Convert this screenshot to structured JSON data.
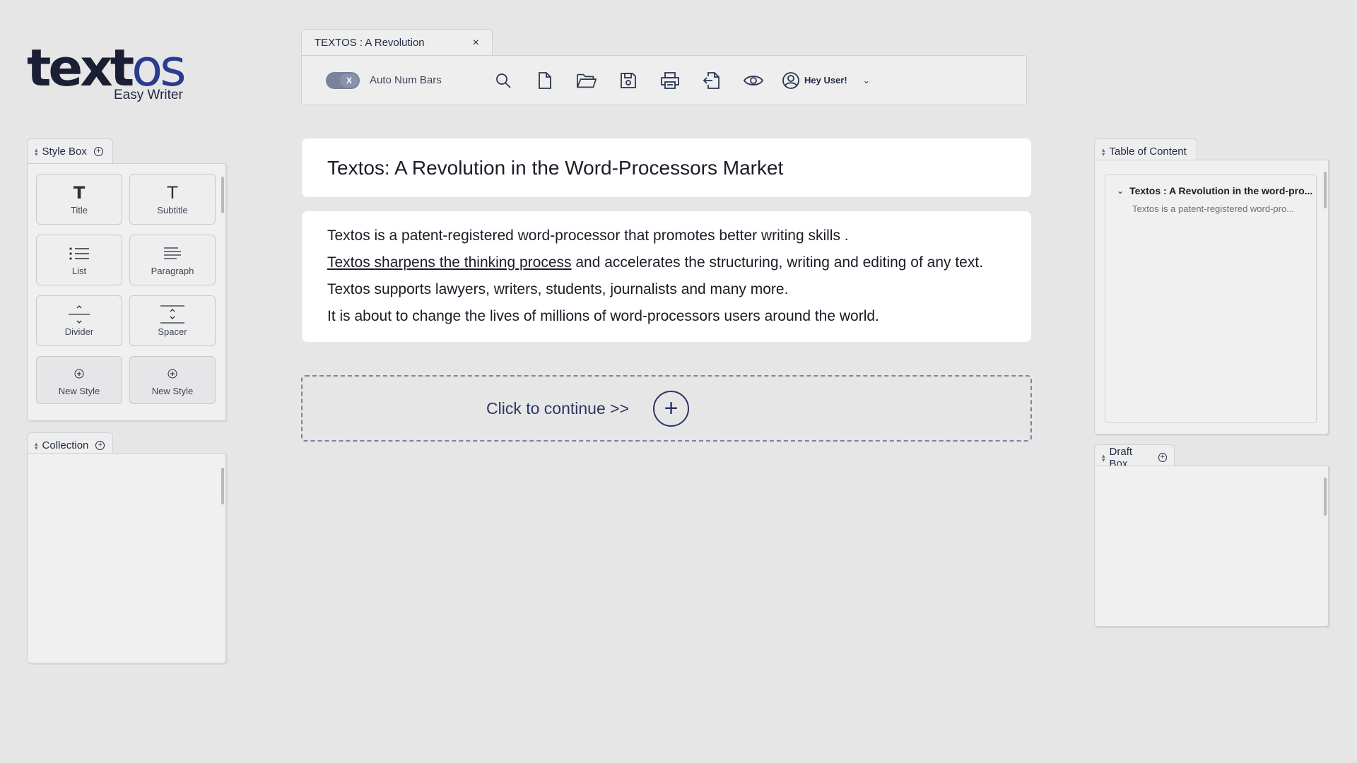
{
  "logo": {
    "word_dark": "text",
    "word_accent": "os",
    "subtitle": "Easy Writer"
  },
  "document_tab": {
    "title": "TEXTOS : A Revolution",
    "close": "×"
  },
  "toolbar": {
    "toggle_state": "X",
    "toggle_label": "Auto Num Bars",
    "icons": [
      "search-icon",
      "new-file-icon",
      "open-folder-icon",
      "save-icon",
      "print-icon",
      "export-icon",
      "preview-icon",
      "user-icon"
    ],
    "user_name": "Hey User!",
    "user_menu_chevron": "⌄"
  },
  "style_box": {
    "title": "Style Box",
    "items": [
      {
        "label": "Title",
        "icon": "title-icon"
      },
      {
        "label": "Subtitle",
        "icon": "subtitle-icon"
      },
      {
        "label": "List",
        "icon": "list-icon"
      },
      {
        "label": "Paragraph",
        "icon": "paragraph-icon"
      },
      {
        "label": "Divider",
        "icon": "divider-icon"
      },
      {
        "label": "Spacer",
        "icon": "spacer-icon"
      },
      {
        "label": "New Style",
        "icon": "plus-icon"
      },
      {
        "label": "New Style",
        "icon": "plus-icon"
      }
    ]
  },
  "collection": {
    "title": "Collection"
  },
  "document": {
    "title": "Textos:  A Revolution in the Word-Processors Market",
    "lines": [
      "Textos is a patent-registered word-processor that promotes better writing skills .",
      "and accelerates the structuring, writing and editing of any text.",
      "Textos supports lawyers, writers, students, journalists and many more.",
      "It is about to change the lives of millions of word-processors users around the world."
    ],
    "underlined_phrase": "Textos sharpens the thinking process"
  },
  "continue": {
    "label": "Click to continue >>",
    "plus": "+"
  },
  "table_of_content": {
    "title": "Table of Content",
    "entry_title": "Textos : A Revolution in the word-pro...",
    "entry_sub": "Textos is a patent-registered word-pro..."
  },
  "draft_box": {
    "title": "Draft Box"
  },
  "colors": {
    "background": "#e6e6e7",
    "accent": "#2b3566",
    "panel": "#f0f0f1",
    "card": "#ffffff"
  }
}
